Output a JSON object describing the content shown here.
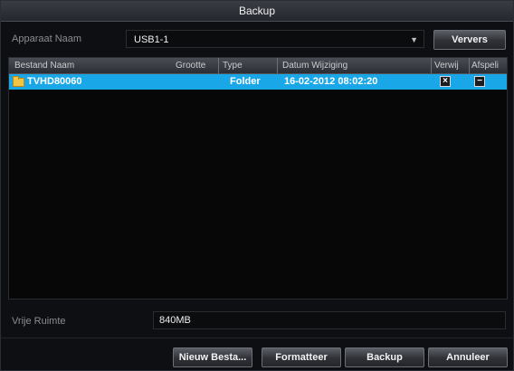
{
  "dialog": {
    "title": "Backup"
  },
  "device": {
    "label": "Apparaat Naam",
    "selected": "USB1-1",
    "refresh_label": "Ververs"
  },
  "table": {
    "headers": [
      "Bestand Naam",
      "Grootte",
      "Type",
      "Datum Wijziging",
      "Verwij",
      "Afspeli"
    ],
    "rows": [
      {
        "name": "TVHD80060",
        "size": "",
        "type": "Folder",
        "date": "16-02-2012 08:02:20",
        "delete_icon": "close-icon",
        "play_icon": "minus-icon"
      }
    ]
  },
  "free_space": {
    "label": "Vrije Ruimte",
    "value": "840MB"
  },
  "buttons": {
    "new_folder": "Nieuw Besta...",
    "format": "Formatteer",
    "backup": "Backup",
    "cancel": "Annuleer"
  },
  "colors": {
    "selection": "#1aa7e8",
    "background": "#0e0f12"
  }
}
